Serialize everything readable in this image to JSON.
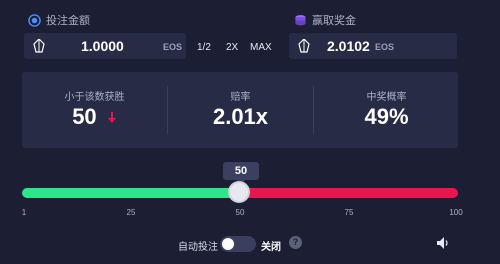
{
  "bet": {
    "label": "投注金额",
    "value": "1.0000",
    "unit": "EOS",
    "buttons": [
      "1/2",
      "2X",
      "MAX"
    ]
  },
  "win": {
    "label": "赢取奖金",
    "value": "2.0102",
    "unit": "EOS"
  },
  "stats": {
    "roll_under_label": "小于该数获胜",
    "roll_under_value": "50",
    "multiplier_label": "赔率",
    "multiplier_value": "2.01x",
    "chance_label": "中奖概率",
    "chance_value": "49%"
  },
  "slider": {
    "value": "50",
    "ticks": [
      "1",
      "25",
      "50",
      "75",
      "100"
    ],
    "colors": {
      "win": "#2fe58a",
      "lose": "#e8164f"
    }
  },
  "auto": {
    "label": "自动投注",
    "state": "关闭",
    "help": "?"
  },
  "icons": {
    "bet_icon": "chip-icon",
    "win_icon": "coin-stack-icon",
    "eos_icon": "eos-icon",
    "arrow_icon": "arrow-down-icon",
    "sound_icon": "speaker-icon"
  }
}
